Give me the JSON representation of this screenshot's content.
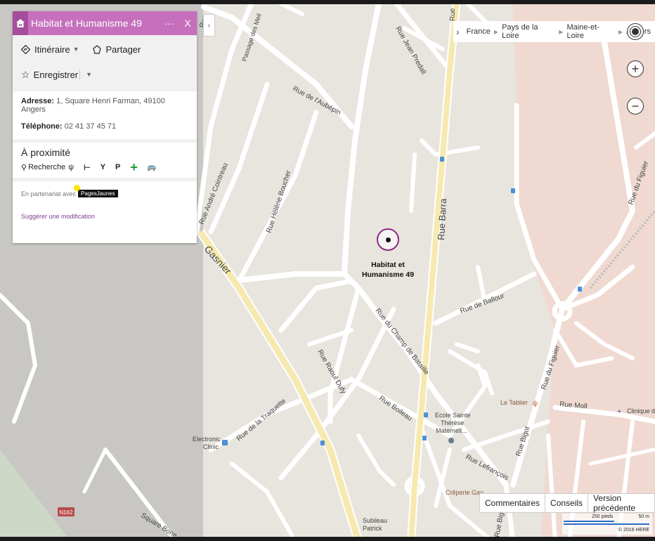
{
  "panel": {
    "title": "Habitat et Humanisme 49",
    "more_label": "···",
    "close_label": "X",
    "directions_label": "Itinéraire",
    "share_label": "Partager",
    "save_label": "Enregistrer",
    "address_label": "Adresse:",
    "address_value": "1, Square Henri Farman, 49100 Angers",
    "phone_label": "Téléphone:",
    "phone_value": "02 41 37 45 71",
    "nearby_title": "À proximité",
    "search_label": "Recherche",
    "partner_text": "En partenariat avec",
    "partner_brand": "PagesJaunes",
    "suggest_label": "Suggérer une modification"
  },
  "breadcrumb": [
    "France",
    "Pays de la Loire",
    "Maine-et-Loire",
    "Angers"
  ],
  "controls": {
    "zoom_in": "+",
    "zoom_out": "−"
  },
  "bottom_bar": {
    "comments": "Commentaires",
    "tips": "Conseils",
    "previous": "Version précédente"
  },
  "scale": {
    "feet": "250 pieds",
    "meters": "50 m",
    "copyright": "© 2016 HERE"
  },
  "place": {
    "line1": "Habitat et",
    "line2": "Humanisme 49"
  },
  "streets": {
    "jean_predali": "Rue Jean Predali",
    "passage_meil": "Passage des Meil",
    "rue_short_top": "Rue",
    "aubepin": "Rue de l'Aubépin",
    "cointreau": "Rue André Cointreau",
    "boucher": "Rue Hélène Boucher",
    "gasnier": "Gasnier",
    "barra": "Rue Barra",
    "figuier_top": "Rue du Figuier",
    "ballour": "Rue de Ballour",
    "champ_bataille": "Rue du Champ de Bataille",
    "dufy": "Rue Raoul Dufy",
    "boileau": "Rue Boileau",
    "traquette": "Rue de la Traquette",
    "lefrancois": "Rue Lefrançois",
    "bigot": "Rue Bigot",
    "figuier_bottom": "Rue du Figuier",
    "moll": "Rue Moll",
    "bone": "Square Bone",
    "big_bottom": "Rue Big",
    "n162": "N162"
  },
  "pois": {
    "electronic1": "Electronic",
    "electronic2": "Clinic",
    "ecole1": "Ecole Sainte",
    "ecole2": "Thérèse",
    "ecole3": "Maternell...",
    "tablier": "Le Tablier",
    "clinique": "Clinique du",
    "creperie": "Crêperie Gau",
    "subileau1": "Subileau",
    "subileau2": "Patrick"
  },
  "colors": {
    "accent": "#c56fbd",
    "accent_dark": "#a54d9c",
    "pin": "#8a2b83",
    "road_major": "#f6e9b0",
    "water_blue": "#2c6ecb"
  }
}
